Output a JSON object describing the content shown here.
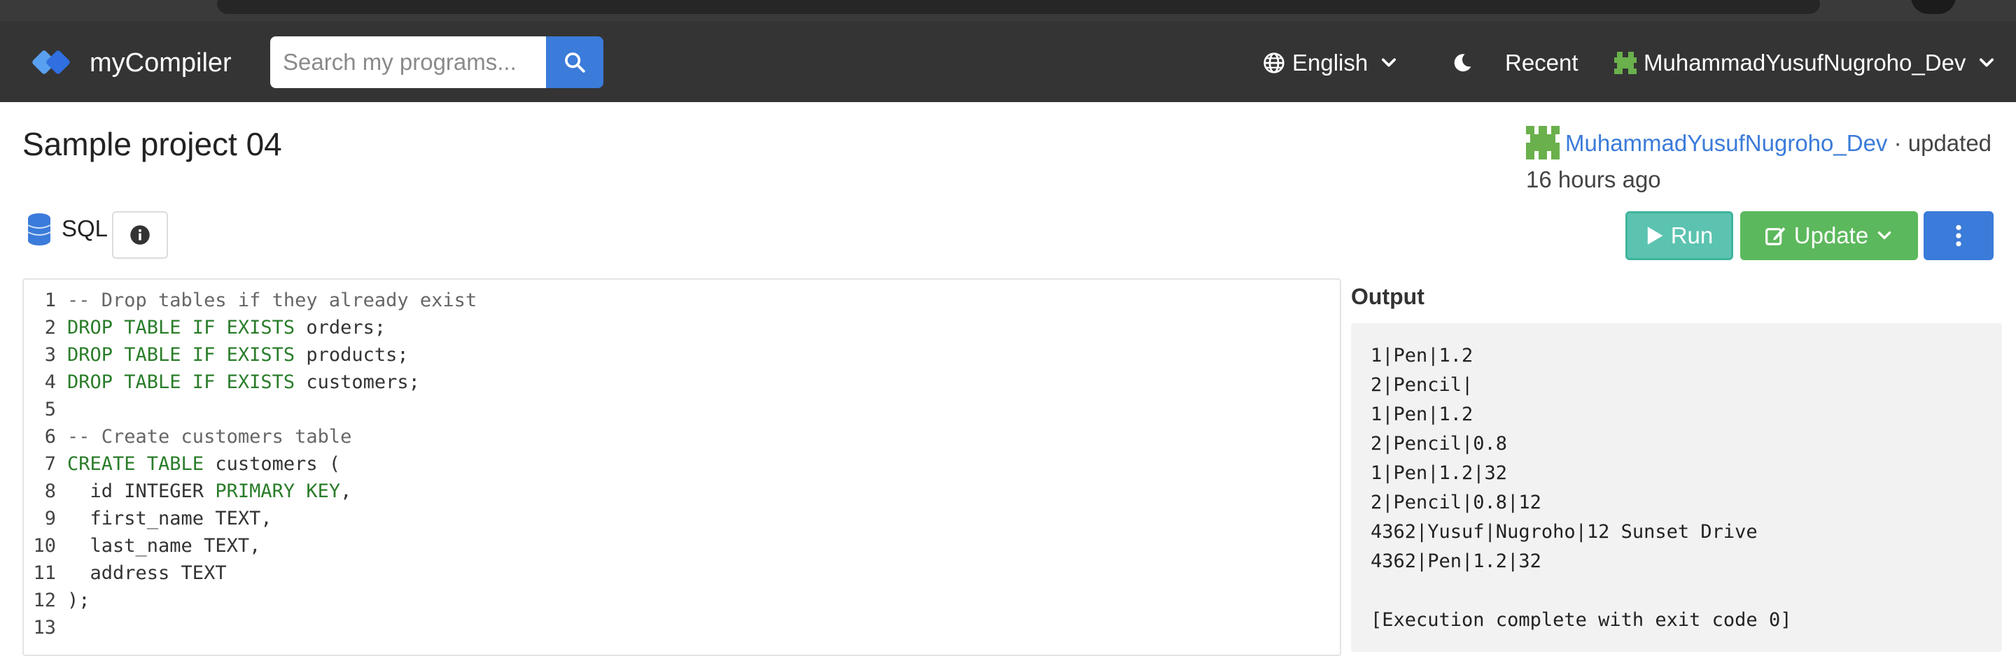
{
  "navbar": {
    "brand": "myCompiler",
    "search_placeholder": "Search my programs...",
    "language": "English",
    "recent": "Recent",
    "username": "MuhammadYusufNugroho_Dev"
  },
  "project": {
    "title": "Sample project 04",
    "author": "MuhammadYusufNugroho_Dev",
    "updated_prefix": "· updated",
    "updated_time": "16 hours ago",
    "language": "SQL"
  },
  "buttons": {
    "run": "Run",
    "update": "Update"
  },
  "editor": {
    "lines": [
      {
        "num": "1",
        "parts": [
          {
            "t": "-- Drop tables if they already exist",
            "c": "cm"
          }
        ]
      },
      {
        "num": "2",
        "parts": [
          {
            "t": "DROP TABLE IF EXISTS",
            "c": "kw"
          },
          {
            "t": " orders;",
            "c": ""
          }
        ]
      },
      {
        "num": "3",
        "parts": [
          {
            "t": "DROP TABLE IF EXISTS",
            "c": "kw"
          },
          {
            "t": " products;",
            "c": ""
          }
        ]
      },
      {
        "num": "4",
        "parts": [
          {
            "t": "DROP TABLE IF EXISTS",
            "c": "kw"
          },
          {
            "t": " customers;",
            "c": ""
          }
        ]
      },
      {
        "num": "5",
        "parts": []
      },
      {
        "num": "6",
        "parts": [
          {
            "t": "-- Create customers table",
            "c": "cm"
          }
        ]
      },
      {
        "num": "7",
        "parts": [
          {
            "t": "CREATE TABLE",
            "c": "kw"
          },
          {
            "t": " customers (",
            "c": ""
          }
        ]
      },
      {
        "num": "8",
        "parts": [
          {
            "t": "  id INTEGER ",
            "c": ""
          },
          {
            "t": "PRIMARY KEY",
            "c": "kw"
          },
          {
            "t": ",",
            "c": ""
          }
        ]
      },
      {
        "num": "9",
        "parts": [
          {
            "t": "  first_name TEXT,",
            "c": ""
          }
        ]
      },
      {
        "num": "10",
        "parts": [
          {
            "t": "  last_name TEXT,",
            "c": ""
          }
        ]
      },
      {
        "num": "11",
        "parts": [
          {
            "t": "  address TEXT",
            "c": ""
          }
        ]
      },
      {
        "num": "12",
        "parts": [
          {
            "t": ");",
            "c": ""
          }
        ]
      },
      {
        "num": "13",
        "parts": []
      }
    ]
  },
  "output": {
    "title": "Output",
    "lines": [
      "1|Pen|1.2",
      "2|Pencil|",
      "1|Pen|1.2",
      "2|Pencil|0.8",
      "1|Pen|1.2|32",
      "2|Pencil|0.8|12",
      "4362|Yusuf|Nugroho|12 Sunset Drive",
      "4362|Pen|1.2|32",
      "",
      "[Execution complete with exit code 0]"
    ]
  },
  "colors": {
    "navbar": "#343434",
    "primary": "#3b7bd9",
    "run": "#5cc3b0",
    "update": "#5cb85c",
    "keyword": "#2a7d2a"
  }
}
